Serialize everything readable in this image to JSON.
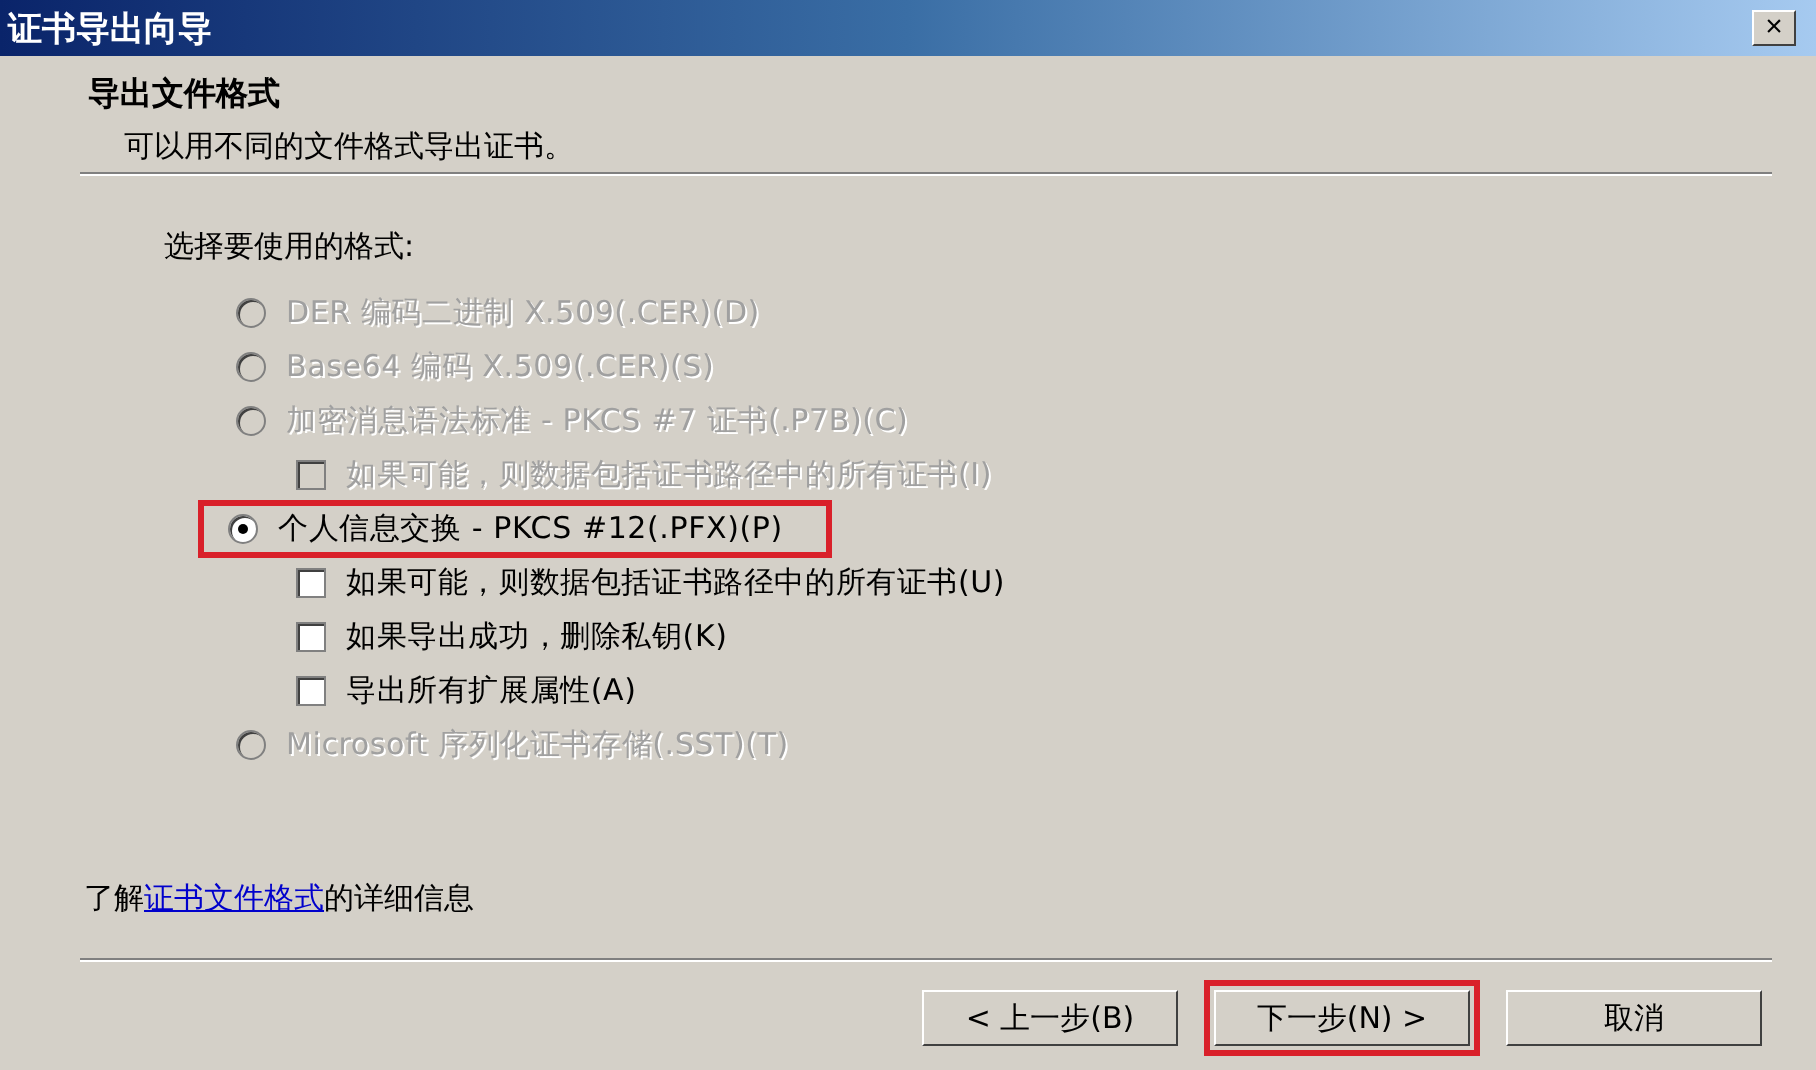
{
  "window": {
    "title": "证书导出向导",
    "close": "×"
  },
  "header": {
    "title": "导出文件格式",
    "subtitle": "可以用不同的文件格式导出证书。"
  },
  "prompt": "选择要使用的格式:",
  "options": [
    {
      "kind": "radio",
      "label": "DER 编码二进制 X.509(.CER)(D)",
      "selected": false,
      "disabled": true,
      "highlighted": false
    },
    {
      "kind": "radio",
      "label": "Base64 编码 X.509(.CER)(S)",
      "selected": false,
      "disabled": true,
      "highlighted": false
    },
    {
      "kind": "radio",
      "label": "加密消息语法标准 - PKCS #7 证书(.P7B)(C)",
      "selected": false,
      "disabled": true,
      "highlighted": false,
      "children": [
        {
          "kind": "checkbox",
          "label": "如果可能，则数据包括证书路径中的所有证书(I)",
          "checked": false,
          "disabled": true
        }
      ]
    },
    {
      "kind": "radio",
      "label": "个人信息交换 - PKCS #12(.PFX)(P)",
      "selected": true,
      "disabled": false,
      "highlighted": true,
      "children": [
        {
          "kind": "checkbox",
          "label": "如果可能，则数据包括证书路径中的所有证书(U)",
          "checked": false,
          "disabled": false
        },
        {
          "kind": "checkbox",
          "label": "如果导出成功，删除私钥(K)",
          "checked": false,
          "disabled": false
        },
        {
          "kind": "checkbox",
          "label": "导出所有扩展属性(A)",
          "checked": false,
          "disabled": false
        }
      ]
    },
    {
      "kind": "radio",
      "label": "Microsoft 序列化证书存储(.SST)(T)",
      "selected": false,
      "disabled": true,
      "highlighted": false
    }
  ],
  "info": {
    "before": "了解",
    "link": "证书文件格式",
    "after": "的详细信息"
  },
  "buttons": [
    {
      "label": "< 上一步(B)",
      "highlighted": false
    },
    {
      "label": "下一步(N) >",
      "highlighted": true
    },
    {
      "label": "取消",
      "highlighted": false
    }
  ]
}
